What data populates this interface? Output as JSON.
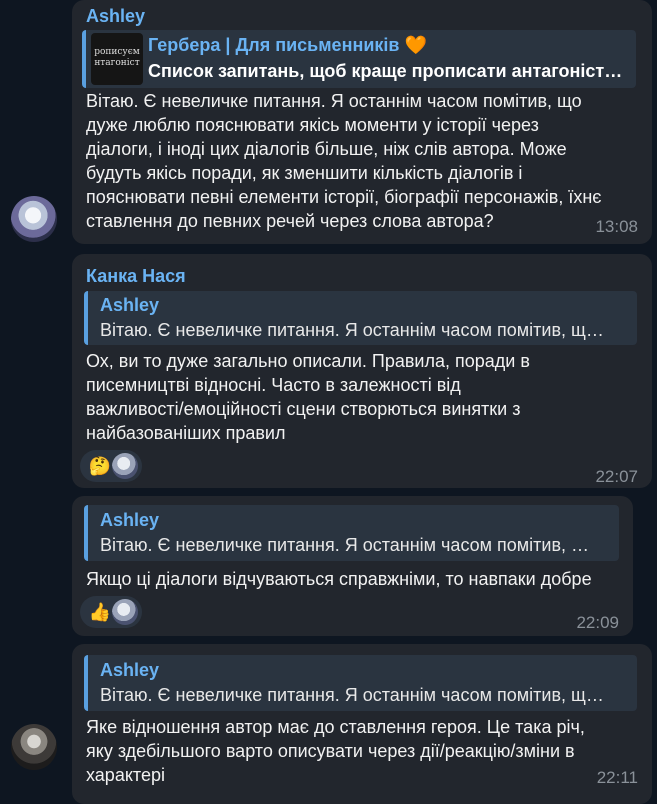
{
  "messages": [
    {
      "sender": "Ashley",
      "forward": {
        "channel": "Гербера | Для письменників",
        "heart": "🧡",
        "title": "Список запитань, щоб краще прописати антагоніст…",
        "thumb_line1": "рописуєм",
        "thumb_line2": "нтагоніст"
      },
      "text": "Вітаю. Є невеличке питання. Я останнім часом помітив, що\nдуже люблю пояснювати якісь моменти у історії через\nдіалоги, і іноді цих діалогів більше, ніж слів автора. Може\nбудуть якісь поради, як зменшити кількість діалогів і\nпояснювати певні елементи історії, біографії персонажів, їхнє\nставлення до певних речей через слова автора?",
      "time": "13:08"
    },
    {
      "sender": "Канка Нася",
      "reply": {
        "name": "Ashley",
        "text": "Вітаю. Є невеличке питання. Я останнім часом помітив, щ…"
      },
      "text": "Ох, ви то дуже загально описали. Правила, поради в\nписемництві відносні. Часто в залежності від\nважливості/емоційності сцени створються винятки з\nнайбазованіших правил",
      "reaction": "🤔",
      "time": "22:07"
    },
    {
      "reply": {
        "name": "Ashley",
        "text": "Вітаю. Є невеличке питання. Я останнім часом помітив, …"
      },
      "text": "Якщо ці діалоги відчуваються справжніми, то навпаки добре",
      "reaction": "👍",
      "time": "22:09"
    },
    {
      "reply": {
        "name": "Ashley",
        "text": "Вітаю. Є невеличке питання. Я останнім часом помітив, щ…"
      },
      "text": "Яке відношення автор має до ставлення героя. Це така річ,\nяку здебільшого варто описувати через дії/реакцію/зміни в\nхарактері",
      "time": "22:11"
    }
  ]
}
